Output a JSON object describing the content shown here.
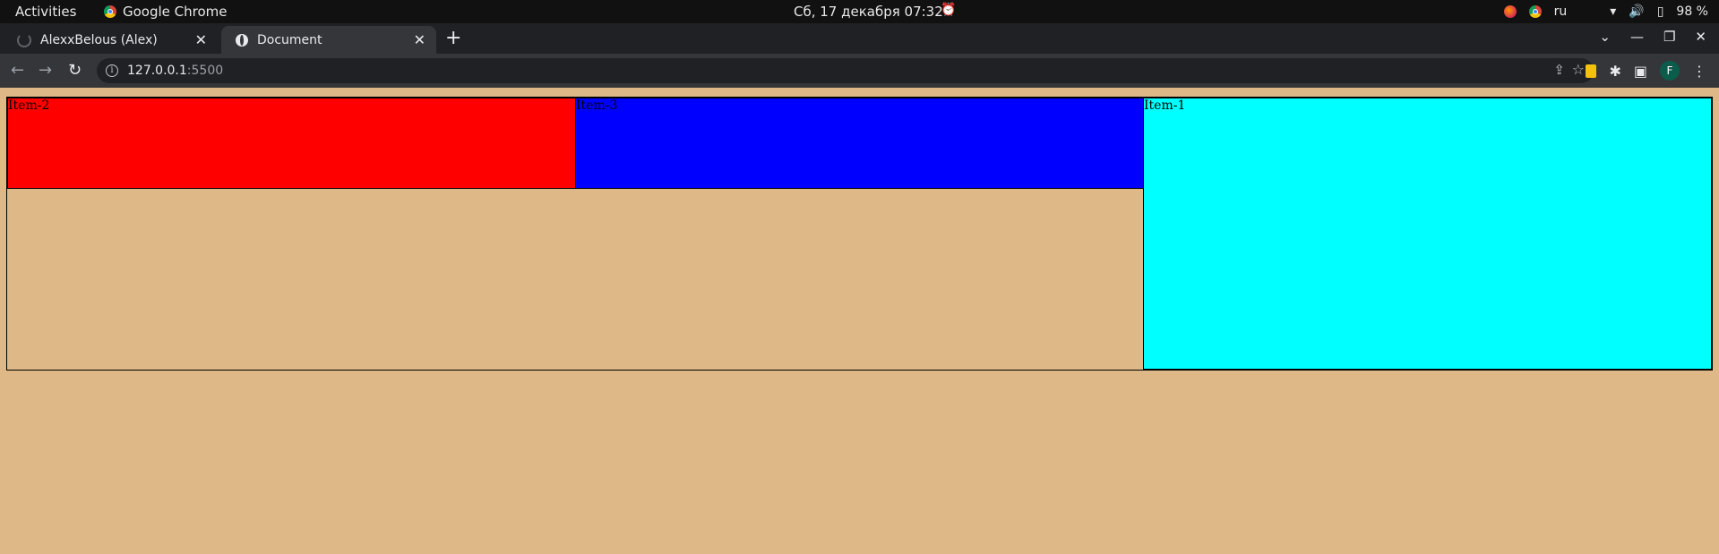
{
  "os_bar": {
    "activities": "Activities",
    "app_name": "Google Chrome",
    "clock": "Сб, 17 декабря  07:32",
    "language": "ru",
    "battery": "98 %"
  },
  "tabs": [
    {
      "label": "AlexxBelous (Alex)",
      "active": false
    },
    {
      "label": "Document",
      "active": true
    }
  ],
  "address_bar": {
    "host": "127.0.0.1",
    "port": ":5500"
  },
  "profile_initial": "F",
  "page": {
    "background": "#deb887",
    "items": [
      {
        "label": "Item-2",
        "color": "#ff0000"
      },
      {
        "label": "Item-3",
        "color": "#0000ff"
      },
      {
        "label": "Item-1",
        "color": "#00ffff"
      }
    ]
  }
}
